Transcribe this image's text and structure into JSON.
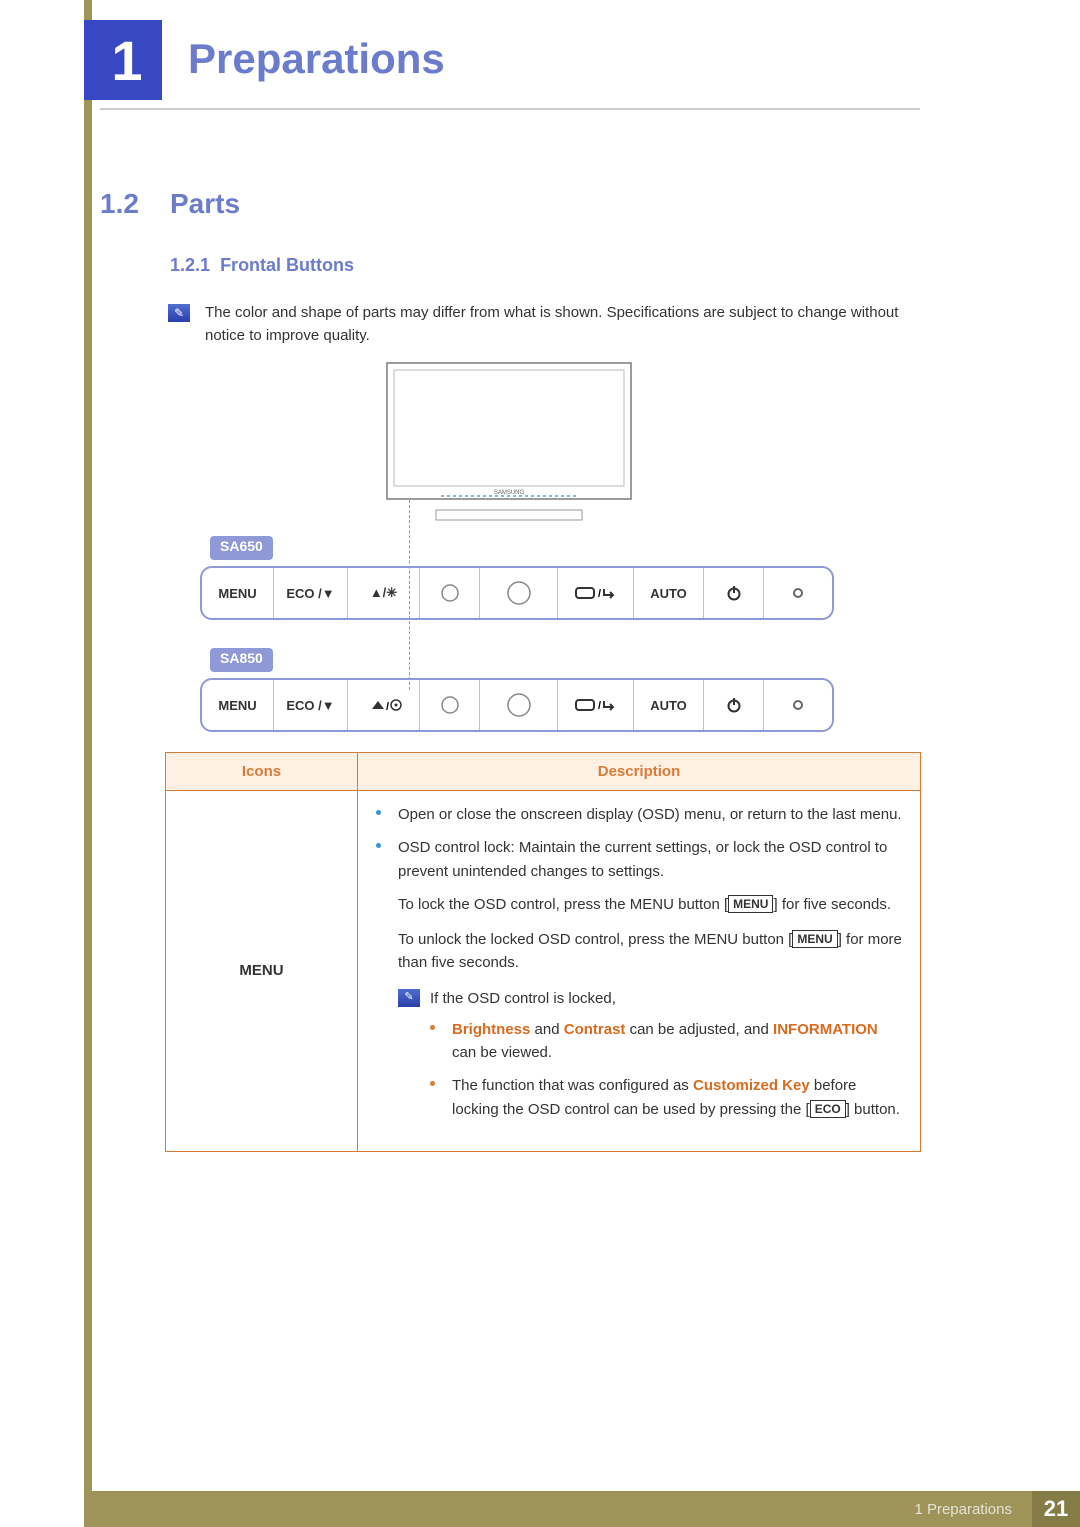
{
  "chapter": {
    "number": "1",
    "title": "Preparations"
  },
  "section": {
    "number": "1.2",
    "title": "Parts"
  },
  "subsection": {
    "number": "1.2.1",
    "title": "Frontal Buttons"
  },
  "noteTop": "The color and shape of parts may differ from what is shown. Specifications are subject to change without notice to improve quality.",
  "panels": {
    "sa650": {
      "label": "SA650",
      "cells": [
        "MENU",
        "ECO /▼",
        "▲/✳",
        "",
        "",
        "▭/↵",
        "AUTO",
        "⏻",
        "○"
      ]
    },
    "sa850": {
      "label": "SA850",
      "cells": [
        "MENU",
        "ECO /▼",
        "▲/◉",
        "",
        "",
        "▭/↵",
        "AUTO",
        "⏻",
        "○"
      ]
    }
  },
  "table": {
    "headers": {
      "icons": "Icons",
      "desc": "Description"
    },
    "rowIcon": "MENU",
    "desc": {
      "b1": "Open or close the onscreen display (OSD) menu, or return to the last menu.",
      "b2": "OSD control lock: Maintain the current settings, or lock the OSD control to prevent unintended changes to settings.",
      "p1a": "To lock the OSD control, press the MENU button [",
      "p1b": "] for five seconds.",
      "p2a": "To unlock the locked OSD control, press the MENU button [",
      "p2b": "] for more than five seconds.",
      "noteLead": "If the OSD control is locked,",
      "nb1a": "Brightness",
      "nb1b": " and ",
      "nb1c": "Contrast",
      "nb1d": " can be adjusted, and ",
      "nb1e": "INFORMATION",
      "nb1f": " can be viewed.",
      "nb2a": "The function that was configured as ",
      "nb2b": "Customized Key",
      "nb2c": " before locking the OSD control can be used by pressing the [",
      "nb2d": "] button.",
      "btnMenu": "MENU",
      "btnEco": "ECO"
    }
  },
  "footer": {
    "text": "1 Preparations",
    "page": "21"
  }
}
